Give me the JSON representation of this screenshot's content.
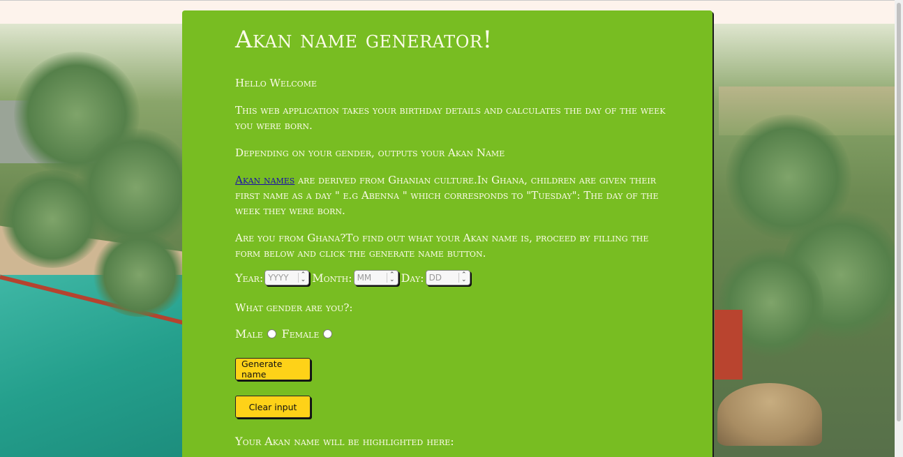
{
  "page": {
    "title": "Akan name generator!",
    "intro": {
      "welcome": "Hello Welcome",
      "description": "This web application takes your birthday details and calculates the day of the week you were born.",
      "gender_note": "Depending on your gender, outputs your Akan Name",
      "akan_link": "Akan names",
      "akan_text": " are derived from Ghanian culture.In Ghana, children are given their first name as a day \" e.g Abenna \" which corresponds to \"Tuesday\": The day of the week they were born.",
      "instructions": "Are you from Ghana?To find out what your Akan name is, proceed by filling the form below and click the generate name button."
    },
    "form": {
      "year_label": "Year:",
      "year_placeholder": "YYYY",
      "month_label": "Month:",
      "month_placeholder": "MM",
      "day_label": "Day:",
      "day_placeholder": "DD",
      "gender_question": "What gender are you?:",
      "male_label": "Male",
      "female_label": "Female",
      "generate_button": "Generate name",
      "clear_button": "Clear input"
    },
    "result_text": "Your Akan name will be highlighted here:"
  },
  "colors": {
    "panel": "#78bd22",
    "button": "#fed218",
    "text": "#fbfbe8",
    "link": "#1a0dab"
  },
  "icons": {
    "spinner": "spin-arrows-icon",
    "radio": "radio-circle-icon"
  }
}
